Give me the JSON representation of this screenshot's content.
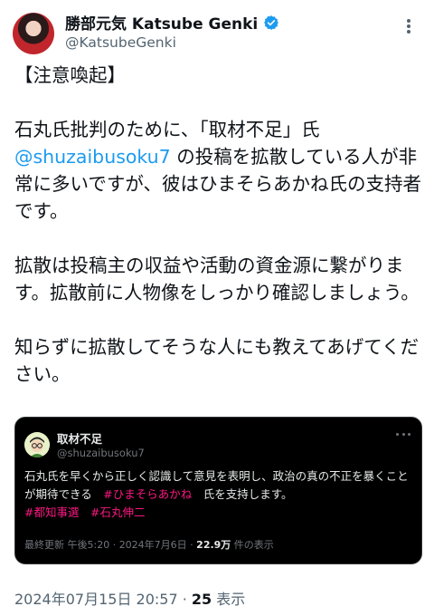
{
  "author": {
    "display_name": "勝部元気 Katsube Genki",
    "handle": "@KatsubeGenki"
  },
  "tweet": {
    "heading": "【注意喚起】",
    "p1_a": "石丸氏批判のために、「取材不足」氏",
    "p1_mention": "@shuzaibusoku7",
    "p1_b": " の投稿を拡散している人が非常に多いですが、彼はひまそらあかね氏の支持者です。",
    "p2": "拡散は投稿主の収益や活動の資金源に繋がります。拡散前に人物像をしっかり確認しましょう。",
    "p3": "知らずに拡散してそうな人にも教えてあげてください。"
  },
  "quoted": {
    "name": "取材不足",
    "handle": "@shuzaibusoku7",
    "text_a": "石丸氏を早くから正しく認識して意見を表明し、政治の真の不正を暴くことが期待できる　",
    "tag1": "#ひまそらあかね",
    "text_b": "　氏を支持します。",
    "tag2": "#都知事選",
    "tag3": "#石丸伸二",
    "meta_prefix": "最終更新 午後5:20 · 2024年7月6日 · ",
    "views": "22.9万",
    "views_suffix": " 件の表示"
  },
  "footer": {
    "timestamp": "2024年07月15日 20:57 · ",
    "count": "25",
    "count_suffix": " 表示"
  },
  "colors": {
    "link": "#1d9bf0",
    "hashtag": "#f91880",
    "verified": "#1d9bf0",
    "quote_bg": "#000000"
  },
  "icons": [
    "verified-badge-icon",
    "more-options-icon",
    "quoted-more-options-icon"
  ]
}
